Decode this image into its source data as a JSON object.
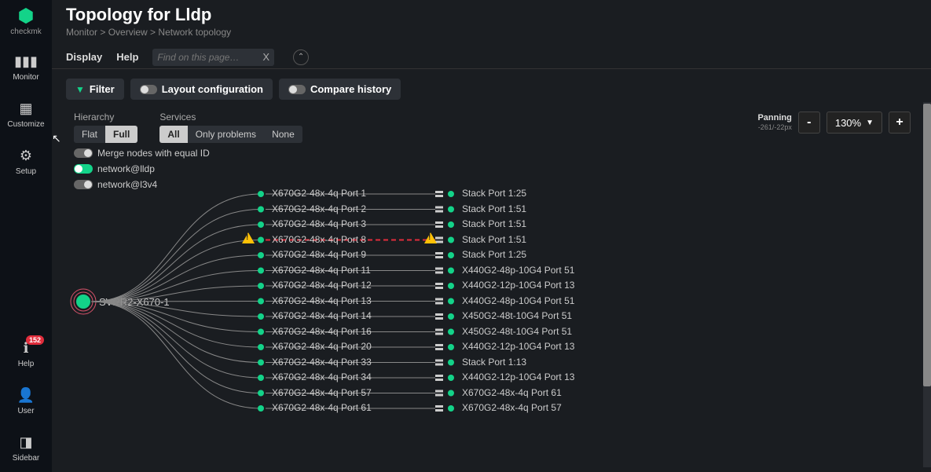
{
  "logo_text": "checkmk",
  "nav": {
    "monitor": "Monitor",
    "customize": "Customize",
    "setup": "Setup",
    "help": "Help",
    "help_badge": "152",
    "user": "User",
    "sidebar": "Sidebar"
  },
  "header": {
    "title": "Topology for Lldp",
    "breadcrumb": [
      "Monitor",
      "Overview",
      "Network topology"
    ]
  },
  "menubar": {
    "display": "Display",
    "help": "Help",
    "search_placeholder": "Find on this page…",
    "search_clear": "X"
  },
  "toolbar": {
    "filter": "Filter",
    "layout": "Layout configuration",
    "compare": "Compare history"
  },
  "controls": {
    "hierarchy_label": "Hierarchy",
    "flat": "Flat",
    "full": "Full",
    "services_label": "Services",
    "all": "All",
    "only_problems": "Only problems",
    "none": "None",
    "merge": "Merge nodes with equal ID",
    "net_lldp": "network@lldp",
    "net_l3v4": "network@l3v4",
    "panning_label": "Panning",
    "panning_val": "-261/-22px",
    "zoom": "130%"
  },
  "root_node": "SVRR2-X670-1",
  "rows": [
    {
      "left": "X670G2-48x-4q Port 1",
      "right": "Stack Port 1:25"
    },
    {
      "left": "X670G2-48x-4q Port 2",
      "right": "Stack Port 1:51"
    },
    {
      "left": "X670G2-48x-4q Port 3",
      "right": "Stack Port 1:51"
    },
    {
      "left": "X670G2-48x-4q Port 8",
      "right": "Stack Port 1:51",
      "warn": true
    },
    {
      "left": "X670G2-48x-4q Port 9",
      "right": "Stack Port 1:25"
    },
    {
      "left": "X670G2-48x-4q Port 11",
      "right": "X440G2-48p-10G4 Port 51"
    },
    {
      "left": "X670G2-48x-4q Port 12",
      "right": "X440G2-12p-10G4 Port 13"
    },
    {
      "left": "X670G2-48x-4q Port 13",
      "right": "X440G2-48p-10G4 Port 51"
    },
    {
      "left": "X670G2-48x-4q Port 14",
      "right": "X450G2-48t-10G4 Port 51"
    },
    {
      "left": "X670G2-48x-4q Port 16",
      "right": "X450G2-48t-10G4 Port 51"
    },
    {
      "left": "X670G2-48x-4q Port 20",
      "right": "X440G2-12p-10G4 Port 13"
    },
    {
      "left": "X670G2-48x-4q Port 33",
      "right": "Stack Port 1:13"
    },
    {
      "left": "X670G2-48x-4q Port 34",
      "right": "X440G2-12p-10G4 Port 13"
    },
    {
      "left": "X670G2-48x-4q Port 57",
      "right": "X670G2-48x-4q Port 61"
    },
    {
      "left": "X670G2-48x-4q Port 61",
      "right": "X670G2-48x-4q Port 57"
    }
  ]
}
